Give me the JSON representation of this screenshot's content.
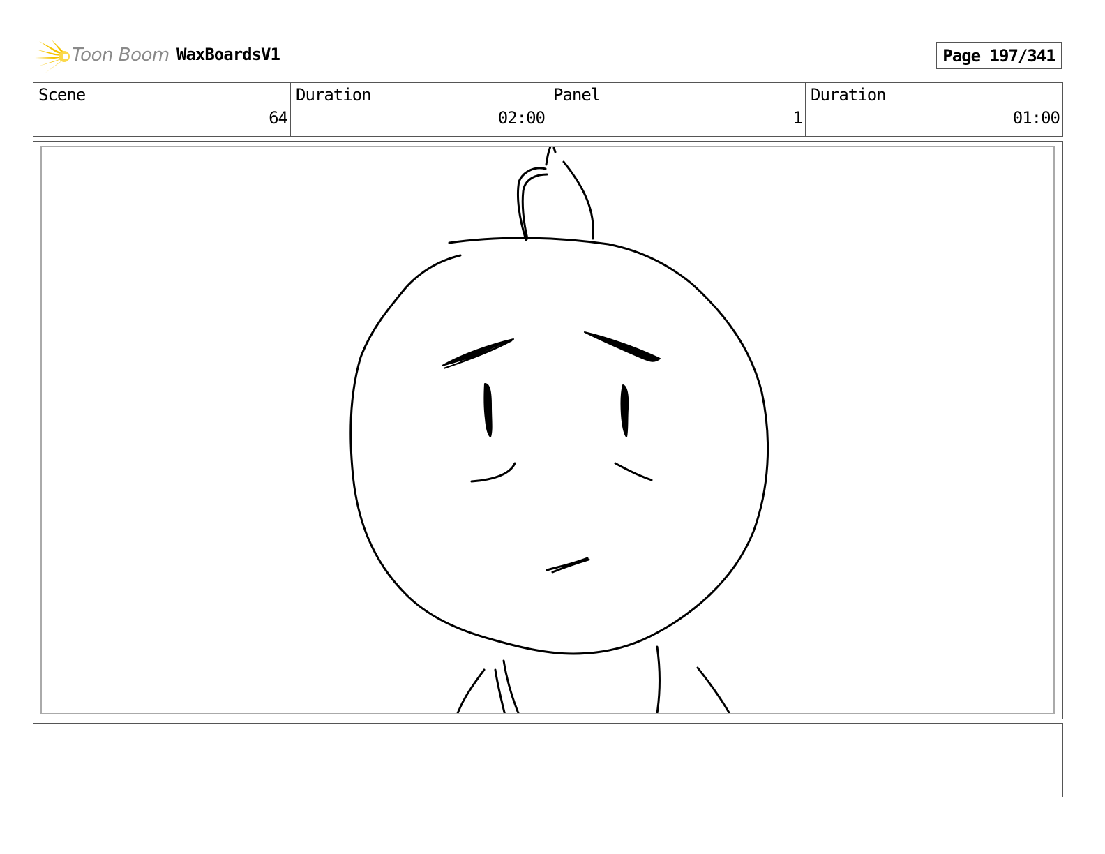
{
  "header": {
    "brand": "Toon Boom",
    "brand_logo_icon": "starburst-logo-icon",
    "brand_logo_color": "#f5c400",
    "project_title": "WaxBoardsV1",
    "page_label": "Page 197/341"
  },
  "info": {
    "scene_label": "Scene",
    "scene_value": "64",
    "scene_duration_label": "Duration",
    "scene_duration_value": "02:00",
    "panel_label": "Panel",
    "panel_value": "1",
    "panel_duration_label": "Duration",
    "panel_duration_value": "01:00"
  },
  "notes": {
    "text": ""
  }
}
